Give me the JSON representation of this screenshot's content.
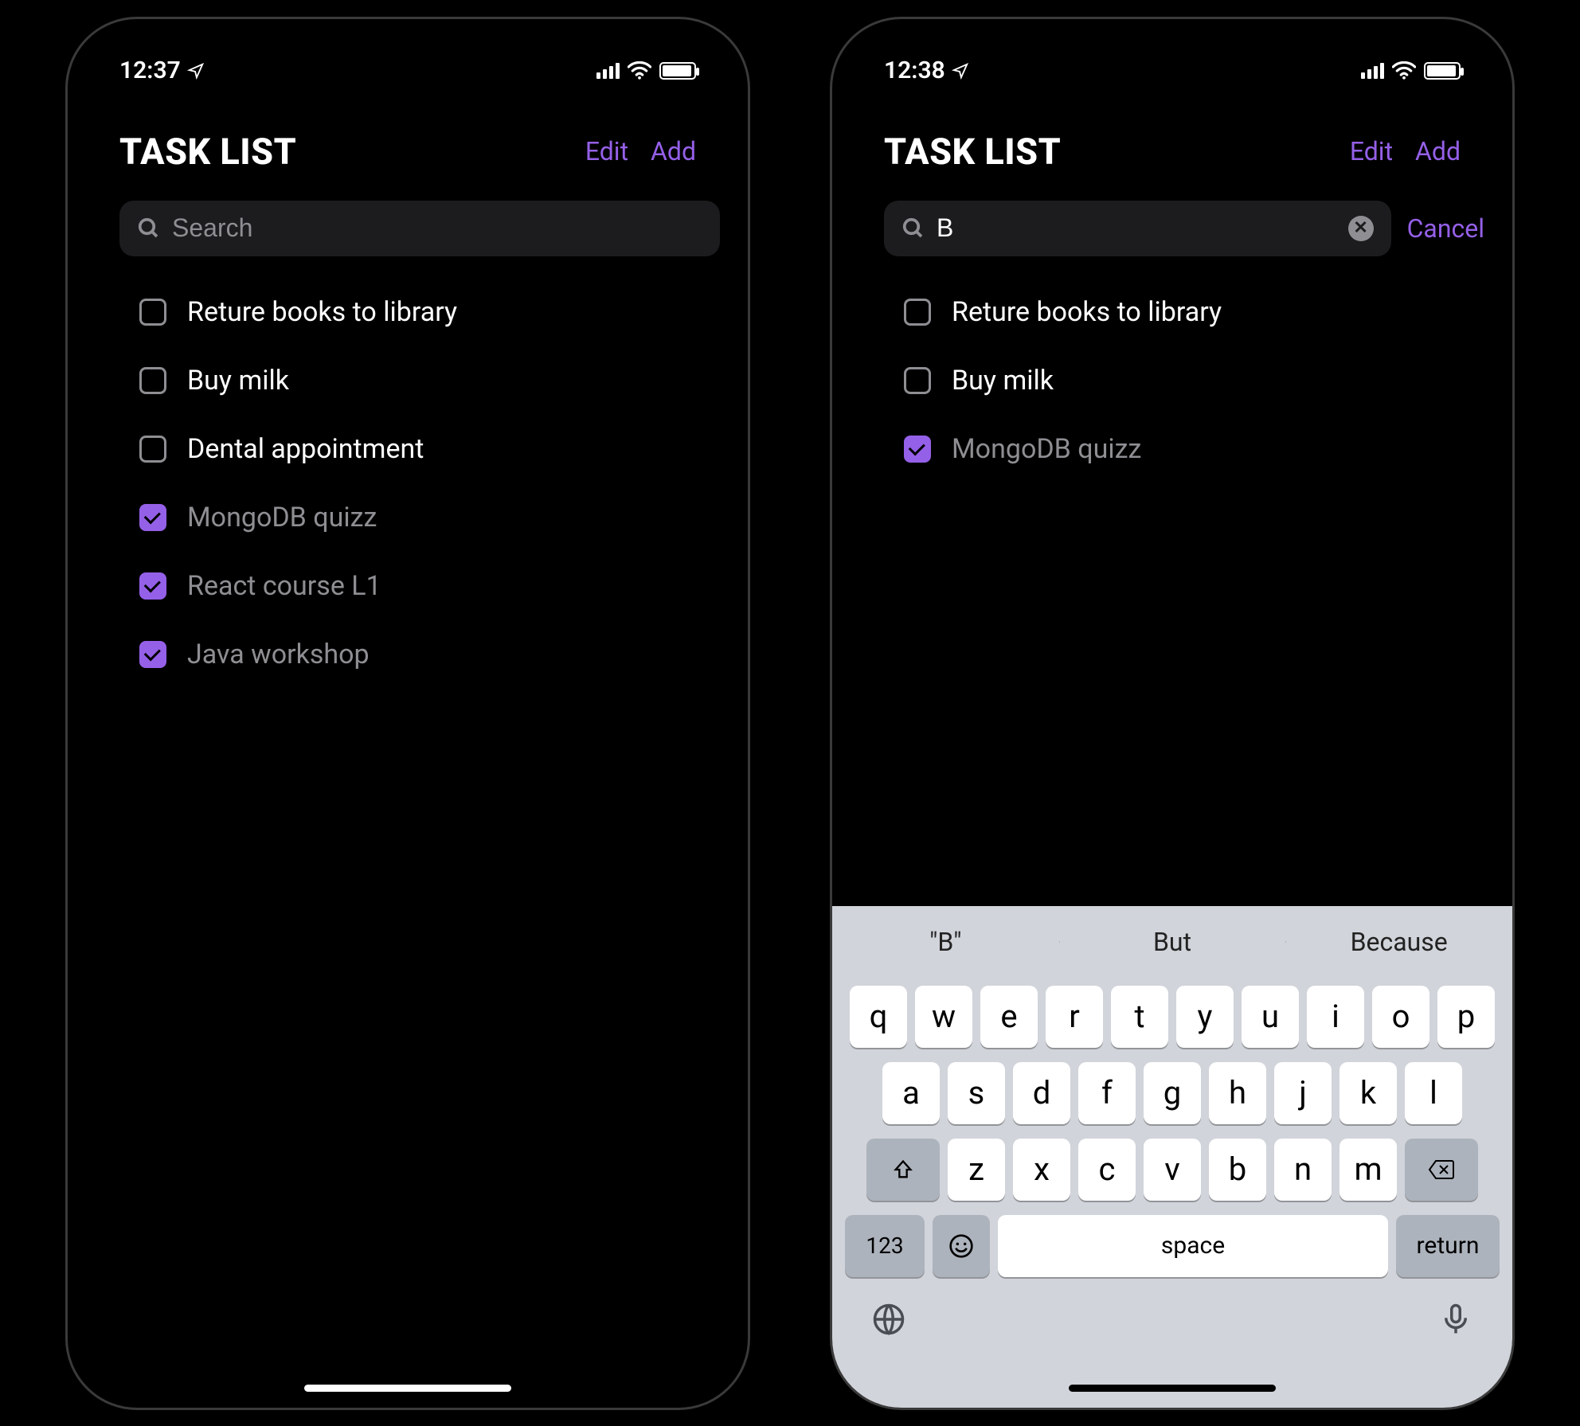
{
  "accent_color": "#9560e8",
  "left": {
    "status": {
      "time": "12:37"
    },
    "title": "TASK LIST",
    "nav": {
      "edit": "Edit",
      "add": "Add"
    },
    "search": {
      "placeholder": "Search",
      "value": ""
    },
    "tasks": [
      {
        "label": "Reture books to library",
        "done": false
      },
      {
        "label": "Buy milk",
        "done": false
      },
      {
        "label": "Dental appointment",
        "done": false
      },
      {
        "label": "MongoDB quizz",
        "done": true
      },
      {
        "label": "React course L1",
        "done": true
      },
      {
        "label": "Java workshop",
        "done": true
      }
    ]
  },
  "right": {
    "status": {
      "time": "12:38"
    },
    "title": "TASK LIST",
    "nav": {
      "edit": "Edit",
      "add": "Add"
    },
    "search": {
      "placeholder": "Search",
      "value": "B",
      "cancel": "Cancel"
    },
    "tasks": [
      {
        "label": "Reture books to library",
        "done": false
      },
      {
        "label": "Buy milk",
        "done": false
      },
      {
        "label": "MongoDB quizz",
        "done": true
      }
    ],
    "keyboard": {
      "suggestions": [
        "\"B\"",
        "But",
        "Because"
      ],
      "row1": [
        "q",
        "w",
        "e",
        "r",
        "t",
        "y",
        "u",
        "i",
        "o",
        "p"
      ],
      "row2": [
        "a",
        "s",
        "d",
        "f",
        "g",
        "h",
        "j",
        "k",
        "l"
      ],
      "row3": [
        "z",
        "x",
        "c",
        "v",
        "b",
        "n",
        "m"
      ],
      "numbers_key": "123",
      "space": "space",
      "return": "return"
    }
  }
}
